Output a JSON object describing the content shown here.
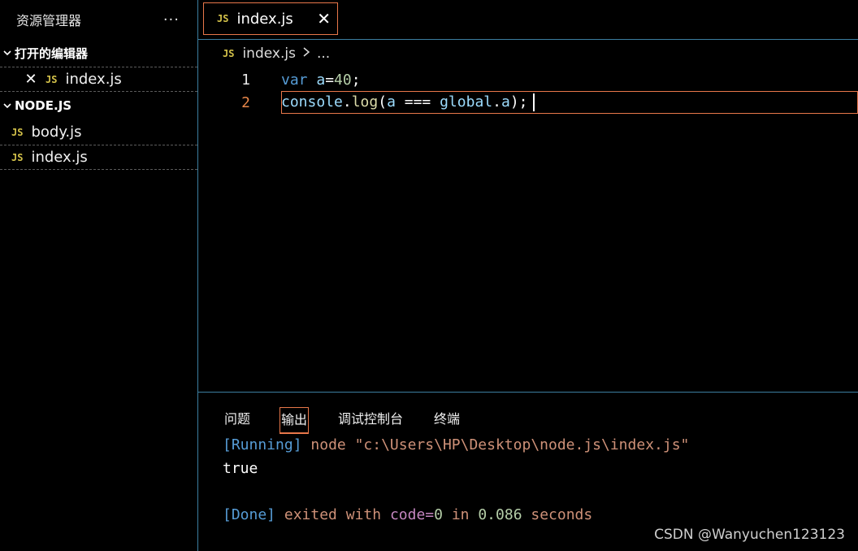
{
  "sidebar": {
    "title": "资源管理器",
    "more": "···",
    "open_editors_label": "打开的编辑器",
    "open_editors": [
      {
        "icon": "JS",
        "name": "index.js",
        "close": "✕"
      }
    ],
    "folder_label": "NODE.JS",
    "files": [
      {
        "icon": "JS",
        "name": "body.js"
      },
      {
        "icon": "JS",
        "name": "index.js"
      }
    ]
  },
  "editor": {
    "tab": {
      "icon": "JS",
      "label": "index.js",
      "close": "✕"
    },
    "breadcrumb": {
      "icon": "JS",
      "file": "index.js",
      "rest": "..."
    },
    "lines": [
      {
        "num": "1"
      },
      {
        "num": "2"
      }
    ]
  },
  "panel": {
    "tabs": [
      "问题",
      "输出",
      "调试控制台",
      "终端"
    ],
    "active_tab": "输出",
    "output": {
      "running_tag": "[Running]",
      "command": "node \"c:\\Users\\HP\\Desktop\\node.js\\index.js\"",
      "result": "true",
      "done_tag": "[Done]",
      "exited": "exited with",
      "code_kw": "code=",
      "code_val": "0",
      "in_word": "in",
      "time": "0.086",
      "seconds": "seconds"
    }
  },
  "watermark": "CSDN @Wanyuchen123123"
}
